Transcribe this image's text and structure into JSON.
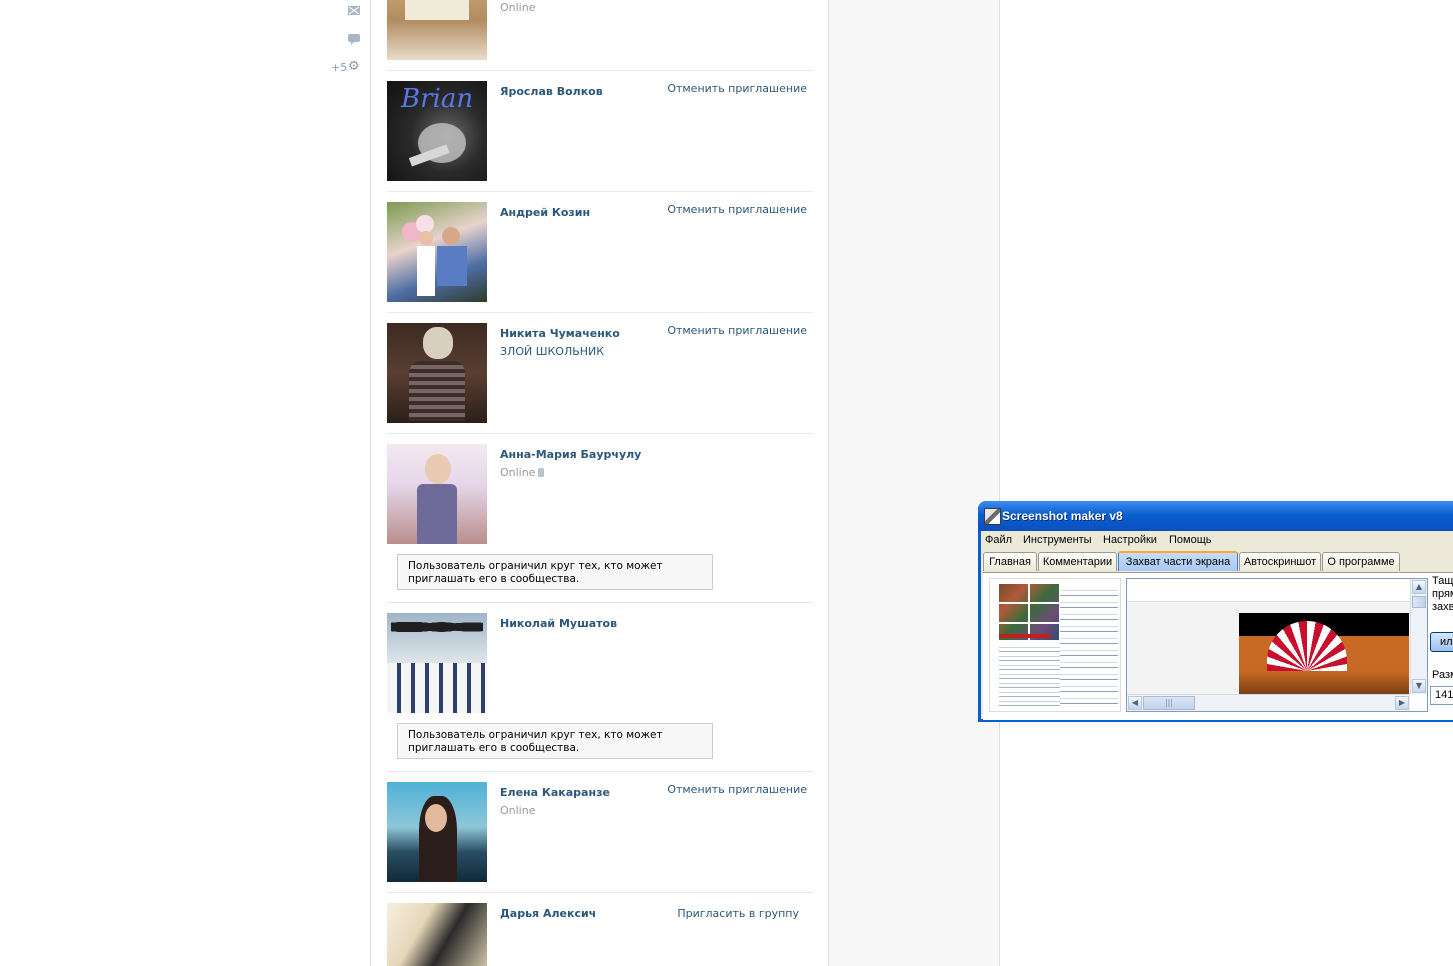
{
  "left_icons": {
    "mail_icon": "mail-icon",
    "chat_icon": "chat-icon",
    "count_label": "+5",
    "gear_icon": "gear-icon"
  },
  "members": [
    {
      "name": "",
      "sub": "Online",
      "action": ""
    },
    {
      "name": "Ярослав Волков",
      "sub": "",
      "action": "Отменить приглашение"
    },
    {
      "name": "Андрей Козин",
      "sub": "",
      "action": "Отменить приглашение"
    },
    {
      "name": "Никита Чумаченко",
      "sub": "ЗЛОЙ ШКОЛЬНИК",
      "action": "Отменить приглашение"
    },
    {
      "name": "Анна-Мария Баурчулу",
      "sub": "Online",
      "action": "",
      "notice": "Пользователь ограничил круг тех, кто может приглашать его в сообщества."
    },
    {
      "name": "Николай Мушатов",
      "sub": "",
      "action": "",
      "notice": "Пользователь ограничил круг тех, кто может приглашать его в сообщества."
    },
    {
      "name": "Елена Какаранзе",
      "sub": "Online",
      "action": "Отменить приглашение"
    },
    {
      "name": "Дарья Алексич",
      "sub": "",
      "action": "Пригласить в группу"
    }
  ],
  "avatar_texts": {
    "brian": "Brian"
  },
  "app_window": {
    "title": "Screenshot maker v8",
    "menu": [
      "Файл",
      "Инструменты",
      "Настройки",
      "Помощь"
    ],
    "tabs": [
      "Главная",
      "Комментарии",
      "Захват части экрана",
      "Автоскриншот",
      "О программе"
    ],
    "active_tab": "Захват части экрана",
    "side_text_lines": [
      "Тащ",
      "прям",
      "захв"
    ],
    "side_button": "или",
    "size_label": "Разм",
    "size_value": "141"
  },
  "colors": {
    "link": "#2b587a",
    "muted": "#999999",
    "xp_blue": "#0a5fd0"
  }
}
